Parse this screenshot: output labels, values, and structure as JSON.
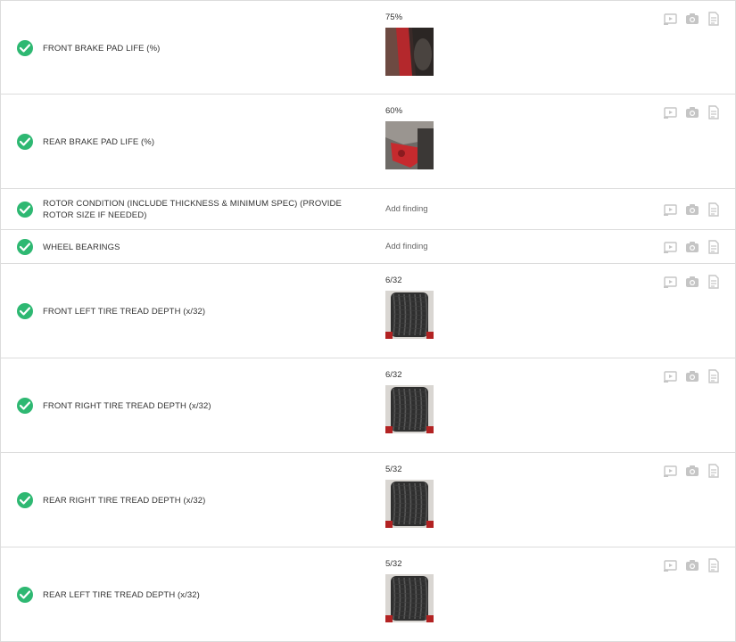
{
  "inspection": {
    "items": [
      {
        "label": "FRONT BRAKE PAD LIFE (%)",
        "value": "75%",
        "has_photo": true,
        "photo": "brake-red"
      },
      {
        "label": "REAR BRAKE PAD LIFE (%)",
        "value": "60%",
        "has_photo": true,
        "photo": "brake-caliper"
      },
      {
        "label": "ROTOR CONDITION (INCLUDE THICKNESS & MINIMUM SPEC) (PROVIDE ROTOR SIZE IF NEEDED)",
        "value": "Add finding",
        "has_photo": false
      },
      {
        "label": "WHEEL BEARINGS",
        "value": "Add finding",
        "has_photo": false
      },
      {
        "label": "FRONT LEFT TIRE TREAD DEPTH (x/32)",
        "value": "6/32",
        "has_photo": true,
        "photo": "tire"
      },
      {
        "label": "FRONT RIGHT TIRE TREAD DEPTH (x/32)",
        "value": "6/32",
        "has_photo": true,
        "photo": "tire"
      },
      {
        "label": "REAR RIGHT TIRE TREAD DEPTH (x/32)",
        "value": "5/32",
        "has_photo": true,
        "photo": "tire"
      },
      {
        "label": "REAR LEFT TIRE TREAD DEPTH (x/32)",
        "value": "5/32",
        "has_photo": true,
        "photo": "tire"
      }
    ]
  },
  "status_icon": "check-circle-icon",
  "row_action_icons": [
    "video-icon",
    "camera-icon",
    "note-icon"
  ],
  "colors": {
    "check": "#2eb872",
    "icon": "#c5c5c5",
    "border": "#dcdcdc"
  }
}
